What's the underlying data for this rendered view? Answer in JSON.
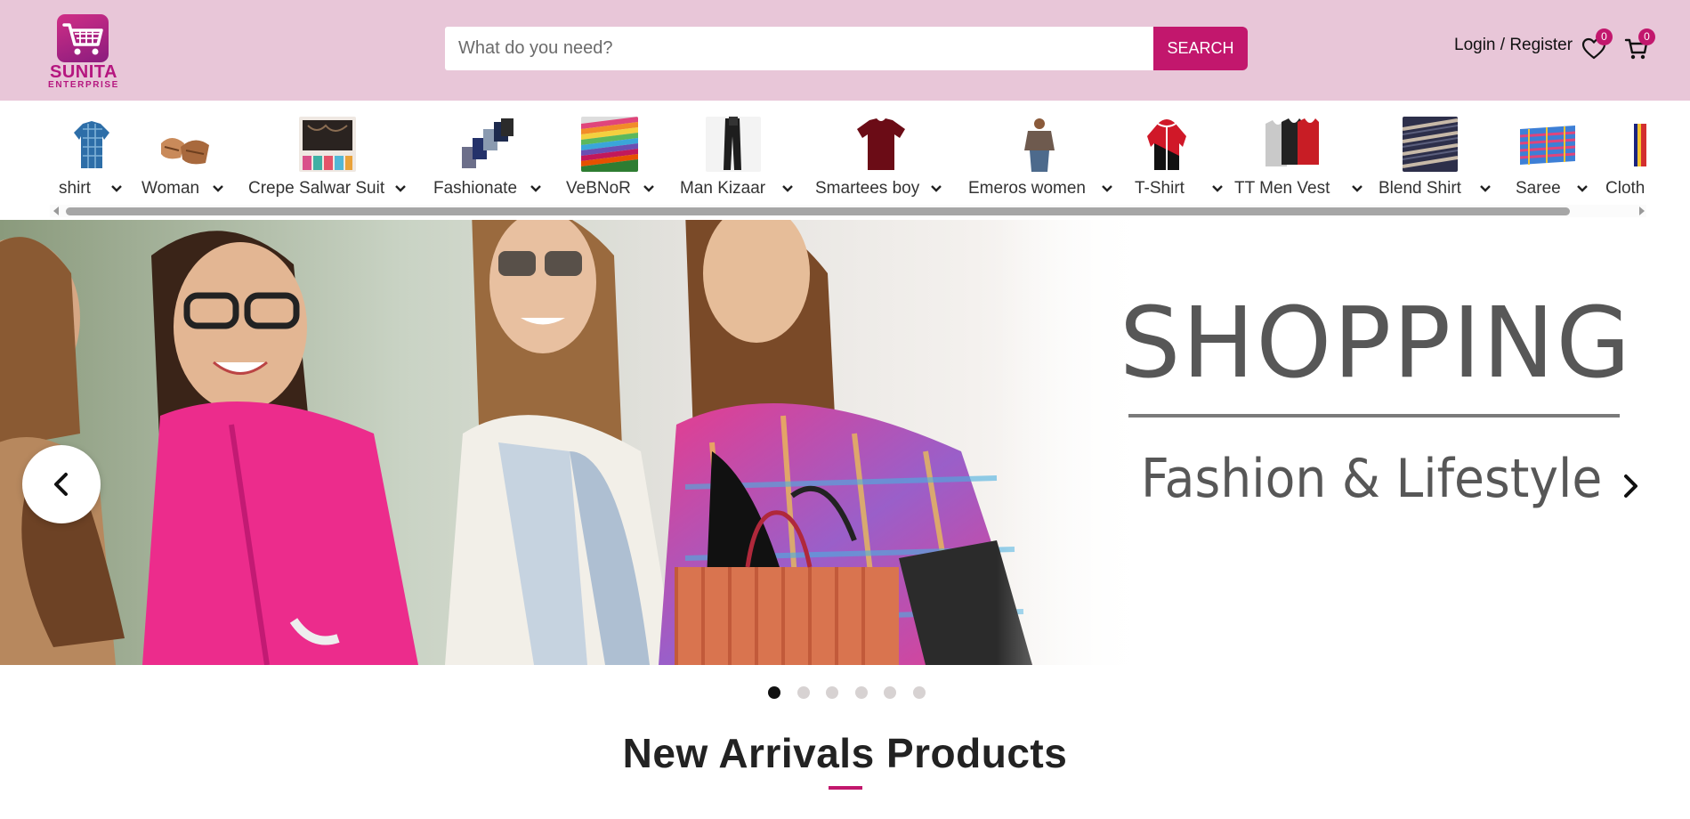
{
  "header": {
    "logo": {
      "name": "SUNITA",
      "subtitle": "ENTERPRISE"
    },
    "search": {
      "placeholder": "What do you need?",
      "value": "",
      "button_label": "SEARCH"
    },
    "account_link": "Login / Register",
    "wishlist": {
      "icon": "heart-icon",
      "count": "0"
    },
    "cart": {
      "icon": "cart-icon",
      "count": "0"
    },
    "accent_color": "#c2176d",
    "background_color": "#e8c6d8"
  },
  "categories": [
    {
      "label": "shirt",
      "icon": "shirt-thumbnail"
    },
    {
      "label": "Woman",
      "icon": "sandals-thumbnail"
    },
    {
      "label": "Crepe Salwar Suit",
      "icon": "salwar-suit-thumbnail"
    },
    {
      "label": "Fashionate",
      "icon": "shorts-thumbnail"
    },
    {
      "label": "VeBNoR",
      "icon": "fabric-thumbnail"
    },
    {
      "label": "Man Kizaar",
      "icon": "trousers-thumbnail"
    },
    {
      "label": "Smartees boy",
      "icon": "tshirt-thumbnail"
    },
    {
      "label": "Emeros women",
      "icon": "women-top-thumbnail"
    },
    {
      "label": "T-Shirt",
      "icon": "hoodie-thumbnail"
    },
    {
      "label": "TT Men Vest",
      "icon": "vest-thumbnail"
    },
    {
      "label": "Blend Shirt",
      "icon": "printed-fabric-thumbnail"
    },
    {
      "label": "Saree",
      "icon": "saree-thumbnail"
    },
    {
      "label": "Cloth",
      "icon": "cloth-thumbnail"
    }
  ],
  "banner": {
    "headline": "SHOPPING",
    "subheadline": "Fashion & Lifestyle",
    "slide_count": 6,
    "active_slide": 1
  },
  "section": {
    "title": "New Arrivals Products"
  }
}
